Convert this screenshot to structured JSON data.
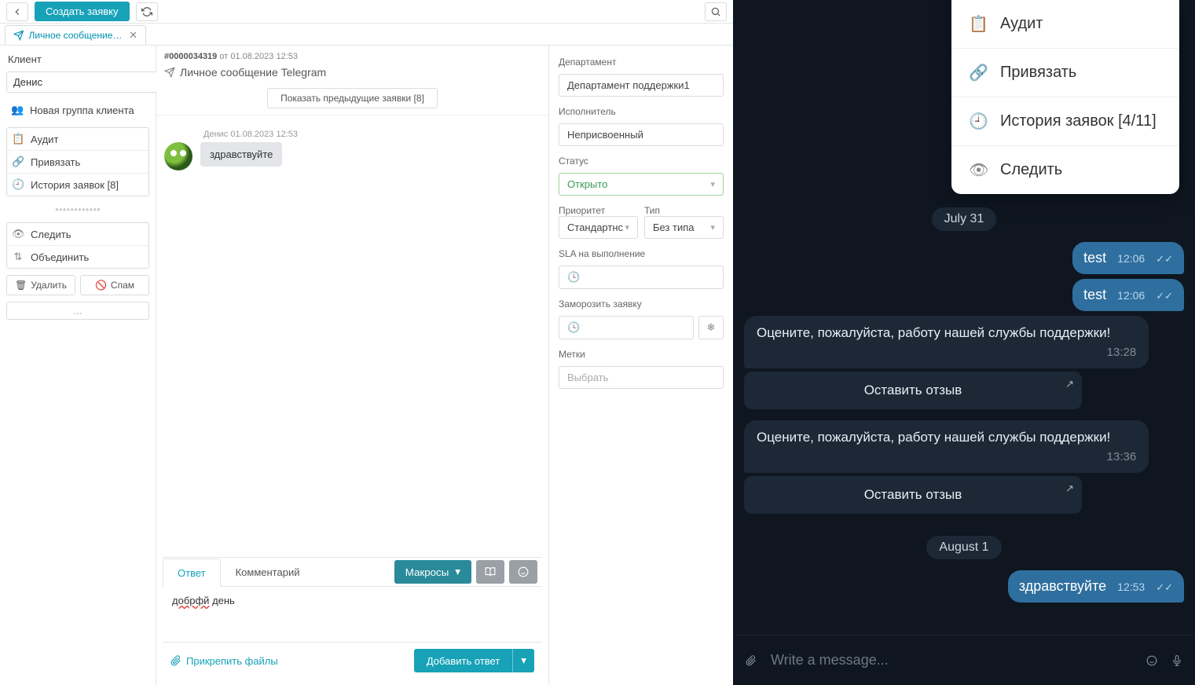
{
  "topbar": {
    "create_label": "Создать заявку"
  },
  "tab": {
    "label": "Личное сообщение Т..."
  },
  "sidebar": {
    "client_label": "Клиент",
    "client_value": "Денис",
    "new_group": "Новая группа клиента",
    "items": [
      {
        "icon": "audit",
        "label": "Аудит"
      },
      {
        "icon": "link",
        "label": "Привязать"
      },
      {
        "icon": "history",
        "label": "История заявок [8]"
      }
    ],
    "items2": [
      {
        "icon": "eye",
        "label": "Следить"
      },
      {
        "icon": "merge",
        "label": "Объединить"
      }
    ],
    "delete": "Удалить",
    "spam": "Спам",
    "ellipsis": "..."
  },
  "ticket": {
    "id": "#0000034319",
    "from": "от 01.08.2023 12:53",
    "title": "Личное сообщение Telegram",
    "show_prev": "Показать предыдущие заявки [8]",
    "msg_author": "Денис 01.08.2023 12:53",
    "msg_text": "здравствуйте"
  },
  "compose": {
    "tab_reply": "Ответ",
    "tab_comment": "Комментарий",
    "macros": "Макросы",
    "draft_pre": "добрфй",
    "draft_post": " день",
    "attach": "Прикрепить файлы",
    "submit": "Добавить ответ"
  },
  "props": {
    "department_label": "Департамент",
    "department_value": "Департамент поддержки1",
    "assignee_label": "Исполнитель",
    "assignee_value": "Неприсвоенный",
    "status_label": "Статус",
    "status_value": "Открыто",
    "priority_label": "Приоритет",
    "priority_value": "Стандартнс",
    "type_label": "Тип",
    "type_value": "Без типа",
    "sla_label": "SLA на выполнение",
    "freeze_label": "Заморозить заявку",
    "tags_label": "Метки",
    "tags_placeholder": "Выбрать"
  },
  "tg": {
    "menu": [
      {
        "icon": "📋",
        "label": "Аудит"
      },
      {
        "icon": "🔗",
        "label": "Привязать"
      },
      {
        "icon": "🕘",
        "label": "История заявок [4/11]"
      },
      {
        "icon": "👁",
        "label": "Следить"
      }
    ],
    "date1": "July 31",
    "out1": {
      "text": "test",
      "time": "12:06"
    },
    "out2": {
      "text": "test",
      "time": "12:06"
    },
    "in1": {
      "text": "Оцените, пожалуйста, работу нашей службы поддержки!",
      "time": "13:28"
    },
    "btn1": "Оставить отзыв",
    "in2": {
      "text": "Оцените, пожалуйста, работу нашей службы поддержки!",
      "time": "13:36"
    },
    "btn2": "Оставить отзыв",
    "date2": "August 1",
    "out3": {
      "text": "здравствуйте",
      "time": "12:53"
    },
    "input_placeholder": "Write a message..."
  }
}
